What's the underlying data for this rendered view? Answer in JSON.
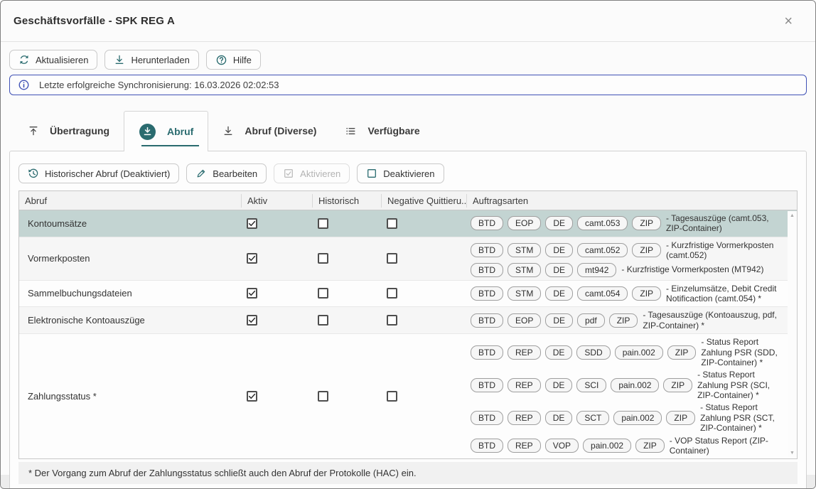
{
  "window": {
    "title": "Geschäftsvorfälle - SPK REG A",
    "close_glyph": "×"
  },
  "toolbar": {
    "buttons": [
      {
        "label": "Aktualisieren",
        "icon": "refresh-icon"
      },
      {
        "label": "Herunterladen",
        "icon": "download-icon"
      },
      {
        "label": "Hilfe",
        "icon": "help-icon"
      }
    ]
  },
  "info_bar": {
    "icon": "info-icon",
    "text": "Letzte erfolgreiche Synchronisierung: 16.03.2026 02:02:53"
  },
  "tabs": [
    {
      "label": "Übertragung",
      "icon": "upload-icon",
      "active": false
    },
    {
      "label": "Abruf",
      "icon": "download-circle-icon",
      "active": true
    },
    {
      "label": "Abruf (Diverse)",
      "icon": "download-icon",
      "active": false
    },
    {
      "label": "Verfügbare",
      "icon": "list-icon",
      "active": false
    }
  ],
  "actions": [
    {
      "label": "Historischer Abruf (Deaktiviert)",
      "icon": "history-icon",
      "enabled": true
    },
    {
      "label": "Bearbeiten",
      "icon": "pencil-icon",
      "enabled": true
    },
    {
      "label": "Aktivieren",
      "icon": "checkbox-checked-icon",
      "enabled": false
    },
    {
      "label": "Deaktivieren",
      "icon": "checkbox-unchecked-icon",
      "enabled": true
    }
  ],
  "table": {
    "columns": [
      "Abruf",
      "Aktiv",
      "Historisch",
      "Negative Quittieru...",
      "Auftragsarten"
    ],
    "rows": [
      {
        "name": "Kontoumsätze",
        "selected": true,
        "aktiv": true,
        "historisch": false,
        "negative_quittierung": false,
        "auftragsarten": [
          {
            "tags": [
              "BTD",
              "EOP",
              "DE",
              "camt.053",
              "ZIP"
            ],
            "description": "- Tagesauszüge (camt.053, ZIP-Container)"
          }
        ]
      },
      {
        "name": "Vormerkposten",
        "selected": false,
        "aktiv": true,
        "historisch": false,
        "negative_quittierung": false,
        "auftragsarten": [
          {
            "tags": [
              "BTD",
              "STM",
              "DE",
              "camt.052",
              "ZIP"
            ],
            "description": "- Kurzfristige Vormerkposten (camt.052)"
          },
          {
            "tags": [
              "BTD",
              "STM",
              "DE",
              "mt942"
            ],
            "description": "- Kurzfristige Vormerkposten (MT942)"
          }
        ]
      },
      {
        "name": "Sammelbuchungsdateien",
        "selected": false,
        "aktiv": true,
        "historisch": false,
        "negative_quittierung": false,
        "auftragsarten": [
          {
            "tags": [
              "BTD",
              "STM",
              "DE",
              "camt.054",
              "ZIP"
            ],
            "description": "- Einzelumsätze, Debit Credit Notificaction (camt.054) *"
          }
        ]
      },
      {
        "name": "Elektronische Kontoauszüge",
        "selected": false,
        "aktiv": true,
        "historisch": false,
        "negative_quittierung": false,
        "auftragsarten": [
          {
            "tags": [
              "BTD",
              "EOP",
              "DE",
              "pdf",
              "ZIP"
            ],
            "description": "- Tagesauszüge (Kontoauszug, pdf, ZIP-Container) *"
          }
        ]
      },
      {
        "name": "Zahlungsstatus *",
        "selected": false,
        "aktiv": true,
        "historisch": false,
        "negative_quittierung": false,
        "auftragsarten": [
          {
            "tags": [
              "BTD",
              "REP",
              "DE",
              "SDD",
              "pain.002",
              "ZIP"
            ],
            "description": "- Status Report Zahlung PSR (SDD, ZIP-Container) *"
          },
          {
            "tags": [
              "BTD",
              "REP",
              "DE",
              "SCI",
              "pain.002",
              "ZIP"
            ],
            "description": "- Status Report Zahlung PSR (SCI, ZIP-Container) *"
          },
          {
            "tags": [
              "BTD",
              "REP",
              "DE",
              "SCT",
              "pain.002",
              "ZIP"
            ],
            "description": "- Status Report Zahlung PSR (SCT, ZIP-Container) *"
          },
          {
            "tags": [
              "BTD",
              "REP",
              "VOP",
              "pain.002",
              "ZIP"
            ],
            "description": "- VOP Status Report (ZIP-Container)"
          }
        ]
      }
    ]
  },
  "footnote": "* Der Vorgang zum Abruf der Zahlungsstatus schließt auch den Abruf der Protokolle (HAC) ein.",
  "colors": {
    "accent_teal": "#2a6b6f",
    "info_border": "#3f51b5",
    "selected_row": "#c3d4d2"
  }
}
